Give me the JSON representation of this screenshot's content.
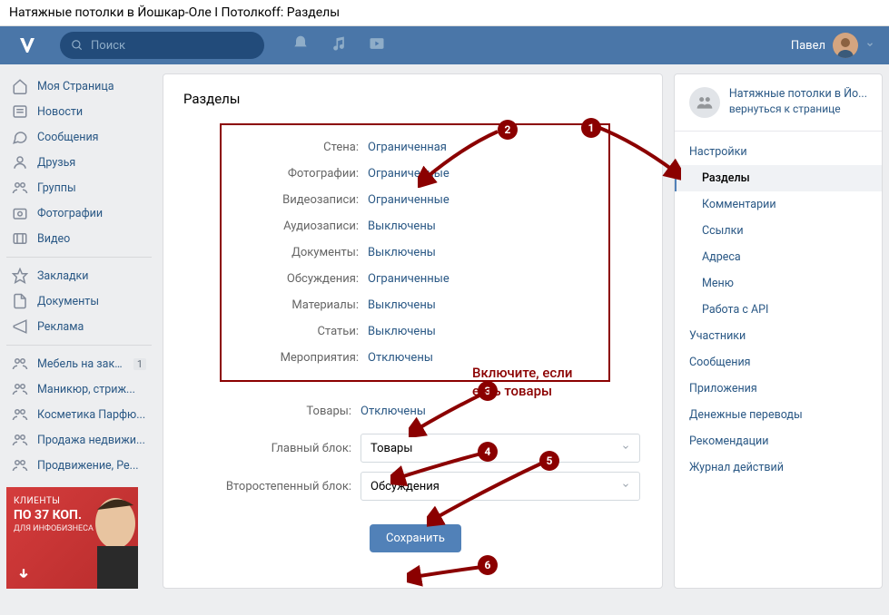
{
  "page_title": "Натяжные потолки в Йошкар-Оле I Потолкоff: Разделы",
  "search": {
    "placeholder": "Поиск"
  },
  "user": {
    "name": "Павел"
  },
  "leftnav": {
    "primary": [
      {
        "label": "Моя Страница",
        "icon": "home"
      },
      {
        "label": "Новости",
        "icon": "news"
      },
      {
        "label": "Сообщения",
        "icon": "messages"
      },
      {
        "label": "Друзья",
        "icon": "friends"
      },
      {
        "label": "Группы",
        "icon": "groups"
      },
      {
        "label": "Фотографии",
        "icon": "photos"
      },
      {
        "label": "Видео",
        "icon": "video"
      }
    ],
    "secondary": [
      {
        "label": "Закладки",
        "icon": "bookmark"
      },
      {
        "label": "Документы",
        "icon": "docs"
      },
      {
        "label": "Реклама",
        "icon": "ads"
      }
    ],
    "shortcuts": [
      {
        "label": "Мебель на зака...",
        "badge": "1"
      },
      {
        "label": "Маникюр, стриж..."
      },
      {
        "label": "Косметика Парфю..."
      },
      {
        "label": "Продажа недвижи..."
      },
      {
        "label": "Продвижение, Ре..."
      }
    ]
  },
  "promo": {
    "line1": "КЛИЕНТЫ",
    "line2": "ПО 37 КОП.",
    "line3": "ДЛЯ ИНФОБИЗНЕСА"
  },
  "main": {
    "heading": "Разделы",
    "settings": [
      {
        "label": "Стена:",
        "value": "Ограниченная"
      },
      {
        "label": "Фотографии:",
        "value": "Ограниченные"
      },
      {
        "label": "Видеозаписи:",
        "value": "Ограниченные"
      },
      {
        "label": "Аудиозаписи:",
        "value": "Выключены"
      },
      {
        "label": "Документы:",
        "value": "Выключены"
      },
      {
        "label": "Обсуждения:",
        "value": "Ограниченные"
      },
      {
        "label": "Материалы:",
        "value": "Выключены"
      },
      {
        "label": "Статьи:",
        "value": "Выключены"
      },
      {
        "label": "Мероприятия:",
        "value": "Отключены"
      }
    ],
    "goods": {
      "label": "Товары:",
      "value": "Отключены"
    },
    "main_block": {
      "label": "Главный блок:",
      "value": "Товары"
    },
    "secondary_block": {
      "label": "Второстепенный блок:",
      "value": "Обсуждения"
    },
    "save": "Сохранить"
  },
  "right": {
    "group_name": "Натяжные потолки в Йо...",
    "back": "вернуться к странице",
    "items": [
      {
        "label": "Настройки",
        "sub": false
      },
      {
        "label": "Разделы",
        "sub": true,
        "active": true
      },
      {
        "label": "Комментарии",
        "sub": true
      },
      {
        "label": "Ссылки",
        "sub": true
      },
      {
        "label": "Адреса",
        "sub": true
      },
      {
        "label": "Меню",
        "sub": true
      },
      {
        "label": "Работа с API",
        "sub": true
      },
      {
        "label": "Участники",
        "sub": false
      },
      {
        "label": "Сообщения",
        "sub": false
      },
      {
        "label": "Приложения",
        "sub": false
      },
      {
        "label": "Денежные переводы",
        "sub": false
      },
      {
        "label": "Рекомендации",
        "sub": false
      },
      {
        "label": "Журнал действий",
        "sub": false
      }
    ]
  },
  "annotations": {
    "n1": "1",
    "n2": "2",
    "n3": "3",
    "n4": "4",
    "n5": "5",
    "n6": "6",
    "note": "Включите, если\nесть товары"
  }
}
